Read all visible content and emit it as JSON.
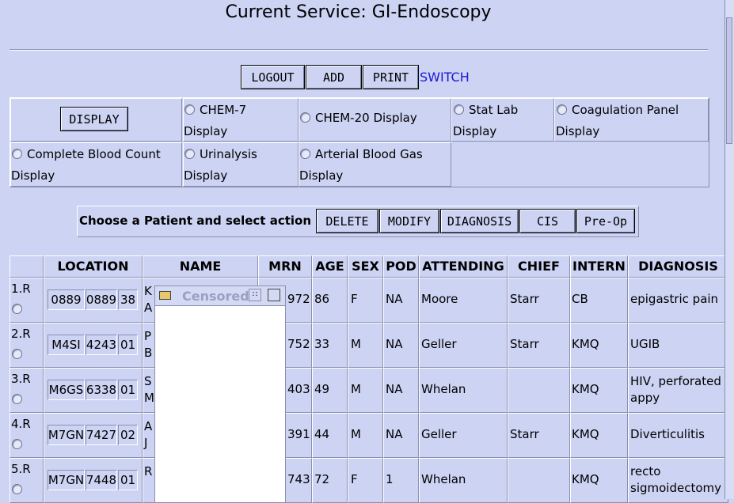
{
  "title": "Current Service: GI-Endoscopy",
  "toolbar": {
    "logout": "LOGOUT",
    "add": "ADD",
    "print": "PRINT",
    "switch": "SWITCH"
  },
  "labs": {
    "display_button": "DISPLAY",
    "chem7": [
      "CHEM-7",
      "Display"
    ],
    "chem20": "CHEM-20 Display",
    "statlab": [
      "Stat Lab",
      "Display"
    ],
    "coag": [
      "Coagulation Panel",
      "Display"
    ],
    "cbc": [
      "Complete Blood Count",
      "Display"
    ],
    "urinalysis": [
      "Urinalysis",
      "Display"
    ],
    "abg": [
      "Arterial Blood Gas",
      "Display"
    ]
  },
  "actions": {
    "prompt": "Choose a Patient and select action",
    "delete": "DELETE",
    "modify": "MODIFY",
    "diagnosis": "DIAGNOSIS",
    "cis": "CIS",
    "preop": "Pre-Op"
  },
  "columns": [
    "LOCATION",
    "NAME",
    "MRN",
    "AGE",
    "SEX",
    "POD",
    "ATTENDING",
    "CHIEF",
    "INTERN",
    "DIAGNOSIS"
  ],
  "rows": [
    {
      "idx": "1.R",
      "loc": [
        "0889",
        "0889",
        "38"
      ],
      "name": [
        "K",
        "A"
      ],
      "mrn": "972",
      "age": "86",
      "sex": "F",
      "pod": "NA",
      "attending": "Moore",
      "chief": "Starr",
      "intern": "CB",
      "diagnosis": [
        "epigastric pain"
      ]
    },
    {
      "idx": "2.R",
      "loc": [
        "M4SI",
        "4243",
        "01"
      ],
      "name": [
        "P",
        "B"
      ],
      "mrn": "752",
      "age": "33",
      "sex": "M",
      "pod": "NA",
      "attending": "Geller",
      "chief": "Starr",
      "intern": "KMQ",
      "diagnosis": [
        "UGIB"
      ]
    },
    {
      "idx": "3.R",
      "loc": [
        "M6GS",
        "6338",
        "01"
      ],
      "name": [
        "S",
        "M"
      ],
      "mrn": "403",
      "age": "49",
      "sex": "M",
      "pod": "NA",
      "attending": "Whelan",
      "chief": "",
      "intern": "KMQ",
      "diagnosis": [
        "HIV, perforated",
        "appy"
      ]
    },
    {
      "idx": "4.R",
      "loc": [
        "M7GN",
        "7427",
        "02"
      ],
      "name": [
        "A",
        "J"
      ],
      "mrn": "391",
      "age": "44",
      "sex": "M",
      "pod": "NA",
      "attending": "Geller",
      "chief": "Starr",
      "intern": "KMQ",
      "diagnosis": [
        "Diverticulitis"
      ]
    },
    {
      "idx": "5.R",
      "loc": [
        "M7GN",
        "7448",
        "01"
      ],
      "name": [
        "R",
        ""
      ],
      "mrn": "743",
      "age": "72",
      "sex": "F",
      "pod": "1",
      "attending": "Whelan",
      "chief": "",
      "intern": "KMQ",
      "diagnosis": [
        "recto",
        "sigmoidectomy"
      ]
    }
  ],
  "popup": {
    "title": "Censored",
    "folder_icon": "folder-icon",
    "restore_icon": "restore-icon",
    "maximize_icon": "maximize-icon"
  }
}
